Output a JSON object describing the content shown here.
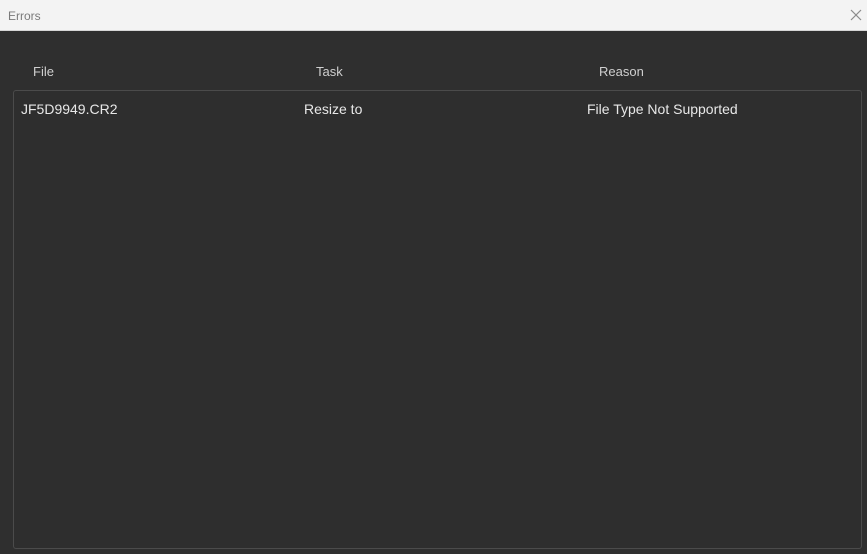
{
  "window": {
    "title": "Errors",
    "close_icon": "close-icon"
  },
  "table": {
    "columns": [
      "File",
      "Task",
      "Reason"
    ],
    "rows": [
      {
        "file": "JF5D9949.CR2",
        "task": "Resize to",
        "reason": "File Type Not Supported"
      }
    ]
  },
  "colors": {
    "background": "#2f2f2f",
    "titlebar": "#f3f3f3",
    "text": "#e8e8e8",
    "header_text": "#cfcfcf"
  }
}
